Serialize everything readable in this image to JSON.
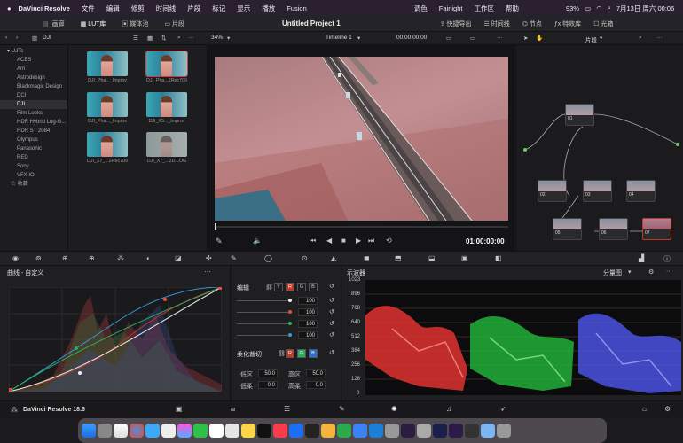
{
  "menubar": {
    "app": "DaVinci Resolve",
    "items": [
      "文件",
      "编辑",
      "修剪",
      "时间线",
      "片段",
      "标记",
      "显示",
      "播放",
      "Fusion"
    ],
    "right_items": [
      "调色",
      "Fairlight",
      "工作区",
      "帮助"
    ],
    "battery": "93%",
    "datetime": "7月13日 周六 00:06"
  },
  "toolbar": {
    "gallery": "画廊",
    "lut_tab": "LUT库",
    "media_pool": "媒体池",
    "clips": "片段",
    "project_title": "Untitled Project 1",
    "quick_export": "快捷导出",
    "timeline": "时间线",
    "nodes": "节点",
    "effects": "特效库",
    "lightbox": "光箱"
  },
  "subbar": {
    "folder": "DJI",
    "zoom": "34%",
    "timeline_name": "Timeline 1",
    "timecode": "00:00:00:00",
    "clip_mode": "片段"
  },
  "lut_tree": {
    "root": "LUTs",
    "items": [
      "ACES",
      "Arri",
      "Astrodesign",
      "Blackmagic Design",
      "DCI",
      "DJI",
      "Film Looks",
      "HDR Hybrid Log-G...",
      "HDR ST 2084",
      "Olympus",
      "Panasonic",
      "RED",
      "Sony",
      "VFX IO"
    ],
    "selected": "DJI",
    "favorites": "收藏"
  },
  "thumbnails": [
    "DJI_Pha..._Improv",
    "DJI_Pha...2Rec709",
    "DJI_Pha..._Improv",
    "DJI_X5..._Improv",
    "DJI_X7_...2Rec709",
    "DJI_X7_...2D.LOG"
  ],
  "viewer": {
    "timecode": "01:00:00:00"
  },
  "nodes": [
    "01",
    "02",
    "03",
    "04",
    "05",
    "06",
    "07"
  ],
  "curves": {
    "title": "曲线 - 自定义"
  },
  "edit_panel": {
    "title": "编辑",
    "channels": [
      "Y",
      "R",
      "G",
      "B"
    ],
    "values": [
      "100",
      "100",
      "100",
      "100"
    ],
    "soft_clip": "柔化裁切",
    "low": "低区",
    "high": "高区",
    "low_soft": "低柔",
    "high_soft": "高柔",
    "low_val": "50.0",
    "high_val": "50.0",
    "low_soft_val": "0.0",
    "high_soft_val": "0.0"
  },
  "scope": {
    "title": "示波器",
    "mode": "分量图",
    "ticks": [
      "1023",
      "896",
      "768",
      "640",
      "512",
      "384",
      "256",
      "128",
      "0"
    ]
  },
  "pagebar": {
    "app_name": "DaVinci Resolve 18.6"
  }
}
